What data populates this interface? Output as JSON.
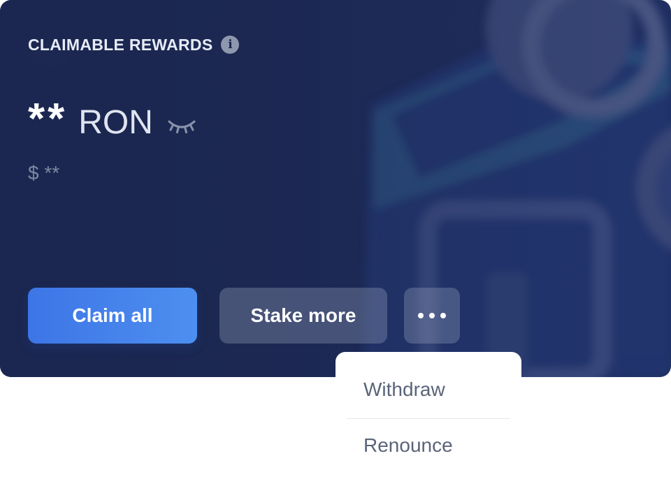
{
  "rewards": {
    "title": "CLAIMABLE REWARDS",
    "info_icon": "info-icon",
    "amount_mask": "**",
    "unit": "RON",
    "hide_icon": "eye-closed-icon",
    "usd_value": "$ **"
  },
  "actions": {
    "claim_label": "Claim all",
    "stake_label": "Stake more",
    "more_icon": "more-horizontal-icon"
  },
  "menu": {
    "items": [
      "Withdraw",
      "Renounce"
    ]
  },
  "colors": {
    "card_bg": "#1b2750",
    "primary": "#4a86ee",
    "secondary_button": "#4a5472",
    "menu_text": "#5a6479"
  }
}
